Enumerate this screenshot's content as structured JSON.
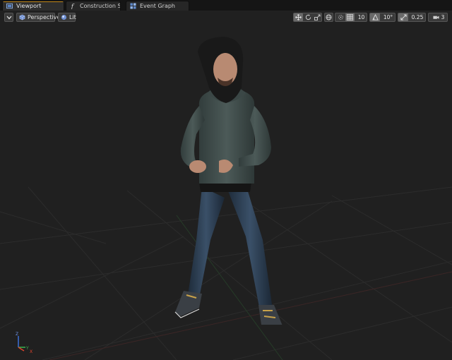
{
  "tabs": [
    {
      "label": "Viewport",
      "icon": "viewport-icon",
      "active": true
    },
    {
      "label": "Construction Scrip",
      "icon": "function-icon",
      "active": false
    },
    {
      "label": "Event Graph",
      "icon": "event-graph-icon",
      "active": false
    }
  ],
  "viewport_toolbar": {
    "options_menu_icon": "chevron-down-icon",
    "view_mode_label": "Perspective",
    "lighting_mode_label": "Lit",
    "grid_snap_value": "10",
    "rotation_snap_value": "10°",
    "scale_snap_value": "0.25",
    "camera_speed_value": "3"
  },
  "axis_labels": {
    "z": "Z",
    "y": "Y",
    "x": "X"
  },
  "colors": {
    "active_tab_accent": "#c48a1c",
    "viewport_background": "#202020",
    "axis_x": "#e0442c",
    "axis_y": "#3fb34f",
    "axis_z": "#3a6fd8"
  }
}
